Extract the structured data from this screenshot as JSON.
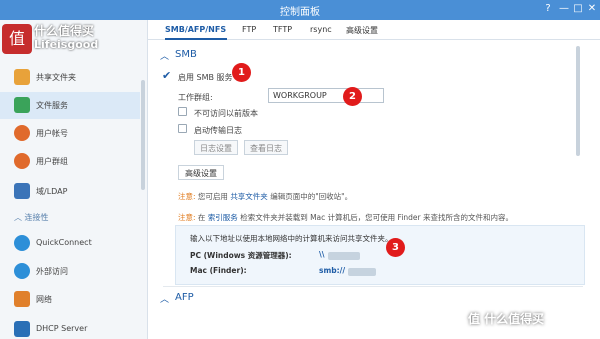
{
  "window": {
    "title": "控制面板"
  },
  "watermark": {
    "logo_char": "值",
    "line1": "什么值得买",
    "line2": "Lifeisgood",
    "bottom": "值 什么值得买"
  },
  "sidebar": {
    "items": [
      {
        "label": "共享文件夹",
        "icon": "folder-share-icon",
        "color": "#e8a23a"
      },
      {
        "label": "文件服务",
        "icon": "file-services-icon",
        "color": "#3aa35a"
      },
      {
        "label": "用户帐号",
        "icon": "user-icon",
        "color": "#e06a2c"
      },
      {
        "label": "用户群组",
        "icon": "user-group-icon",
        "color": "#e06a2c"
      },
      {
        "label": "域/LDAP",
        "icon": "domain-ldap-icon",
        "color": "#3b74b8"
      },
      {
        "label": "QuickConnect",
        "icon": "quickconnect-icon",
        "color": "#2d8fd8"
      },
      {
        "label": "外部访问",
        "icon": "external-access-icon",
        "color": "#2d8fd8"
      },
      {
        "label": "网络",
        "icon": "network-icon",
        "color": "#e0802c"
      },
      {
        "label": "DHCP Server",
        "icon": "dhcp-server-icon",
        "color": "#2a6fb6"
      }
    ],
    "section_connectivity": "连接性"
  },
  "tabs": [
    "SMB/AFP/NFS",
    "FTP",
    "TFTP",
    "rsync",
    "高级设置"
  ],
  "smb": {
    "header": "SMB",
    "enable_label": "启用 SMB 服务",
    "workgroup_label": "工作群组:",
    "workgroup_value": "WORKGROUP",
    "hide_prev_label": "不可访问以前版本",
    "transfer_log_label": "启动传输日志",
    "log_settings_btn": "日志设置",
    "view_log_btn": "查看日志",
    "advanced_btn": "高级设置"
  },
  "notes": {
    "note1_prefix": "注意:",
    "note1_text_a": "您可启用",
    "note1_link": "共享文件夹",
    "note1_text_b": "编辑页面中的\"回收站\"。",
    "note2_prefix": "注意:",
    "note2_text_a": "在",
    "note2_link": "索引服务",
    "note2_text_b": "检索文件夹并装载到 Mac 计算机后，您可使用 Finder 来查找所含的文件和内容。"
  },
  "info": {
    "intro": "输入以下地址以使用本地网络中的计算机来访问共享文件夹。",
    "pc_label": "PC (Windows 资源管理器):",
    "pc_value": "\\\\",
    "mac_label": "Mac (Finder):",
    "mac_value": "smb://"
  },
  "afp": {
    "header": "AFP"
  },
  "badges": [
    "1",
    "2",
    "3"
  ]
}
